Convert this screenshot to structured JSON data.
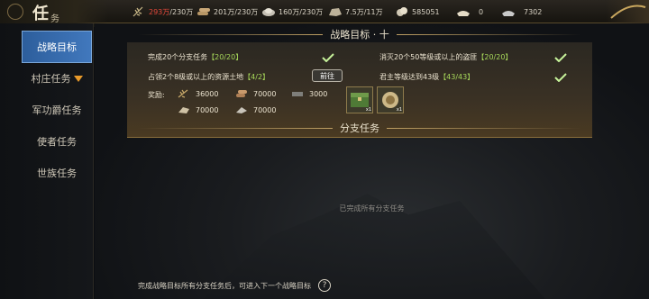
{
  "header": {
    "title_main": "任",
    "title_sub": "务",
    "resources": [
      {
        "icon": "grain-icon",
        "current": "293万",
        "max": "/230万",
        "over": true
      },
      {
        "icon": "wood-icon",
        "current": "201万",
        "max": "/230万",
        "over": false
      },
      {
        "icon": "iron-icon",
        "current": "160万",
        "max": "/230万",
        "over": false
      },
      {
        "icon": "stone-icon",
        "current": "7.5万",
        "max": "/11万",
        "over": false
      },
      {
        "icon": "copper-coin-icon",
        "current": "585051",
        "max": "",
        "over": false
      },
      {
        "icon": "gold-ingot-icon",
        "current": "0",
        "max": "",
        "over": false
      },
      {
        "icon": "silver-ingot-icon",
        "current": "7302",
        "max": "",
        "over": false
      }
    ]
  },
  "sidebar": {
    "items": [
      {
        "label": "战略目标",
        "active": true
      },
      {
        "label": "村庄任务",
        "active": false,
        "has_arrow": true
      },
      {
        "label": "军功爵任务",
        "active": false
      },
      {
        "label": "使者任务",
        "active": false
      },
      {
        "label": "世族任务",
        "active": false
      }
    ]
  },
  "strategic": {
    "title": "战略目标 · 十",
    "goals": [
      {
        "text": "完成20个分支任务",
        "progress": "【20/20】",
        "done": true
      },
      {
        "text": "消灭20个50等级或以上的盗匪",
        "progress": "【20/20】",
        "done": true
      },
      {
        "text": "占领2个8级或以上的资源土地",
        "progress": "【4/2】",
        "done": true
      },
      {
        "text": "君主等级达到43级",
        "progress": "【43/43】",
        "done": true
      }
    ],
    "goto_label": "前往",
    "reward_label": "奖励:",
    "rewards": [
      {
        "icon": "grain-icon",
        "amount": "36000"
      },
      {
        "icon": "wood-icon",
        "amount": "70000"
      },
      {
        "icon": "iron-icon",
        "amount": "3000"
      },
      {
        "icon": "stone-icon",
        "amount": "70000"
      },
      {
        "icon": "iron-icon",
        "amount": "70000"
      }
    ],
    "items": [
      {
        "icon": "chest-icon",
        "qty": "x1"
      },
      {
        "icon": "medal-icon",
        "qty": "x1"
      }
    ]
  },
  "branch": {
    "title": "分支任务",
    "empty_text": "已完成所有分支任务"
  },
  "footer": {
    "hint": "完成战略目标所有分支任务后，可进入下一个战略目标",
    "help_label": "?"
  },
  "colors": {
    "accent_blue": "#3a6fb0",
    "progress_green": "#a7d85a",
    "over_red": "#e4483b",
    "gold_border": "#bfa064"
  }
}
